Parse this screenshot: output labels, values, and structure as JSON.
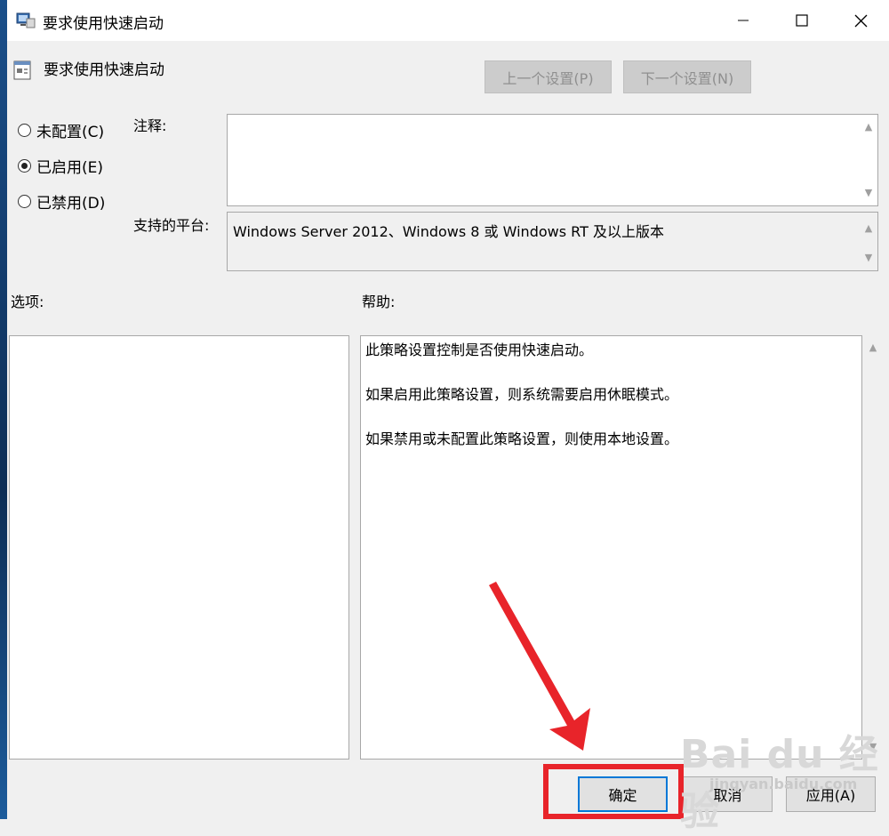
{
  "window": {
    "title": "要求使用快速启动"
  },
  "header": {
    "policy_name": "要求使用快速启动",
    "prev_button": "上一个设置(P)",
    "next_button": "下一个设置(N)"
  },
  "state_options": [
    {
      "label": "未配置(C)",
      "checked": false
    },
    {
      "label": "已启用(E)",
      "checked": true
    },
    {
      "label": "已禁用(D)",
      "checked": false
    }
  ],
  "comment": {
    "label": "注释:",
    "value": ""
  },
  "platform": {
    "label": "支持的平台:",
    "value": "Windows Server 2012、Windows 8 或 Windows RT 及以上版本"
  },
  "options": {
    "label": "选项:"
  },
  "help": {
    "label": "帮助:",
    "paragraphs": [
      "此策略设置控制是否使用快速启动。",
      "如果启用此策略设置，则系统需要启用休眠模式。",
      "如果禁用或未配置此策略设置，则使用本地设置。"
    ]
  },
  "footer": {
    "ok_button": "确定",
    "cancel_button": "取消",
    "apply_button": "应用(A)"
  },
  "watermark": {
    "brand": "Bai du 经验",
    "url": "jingyan.baidu.com"
  },
  "annotation_color": "#e8242a"
}
